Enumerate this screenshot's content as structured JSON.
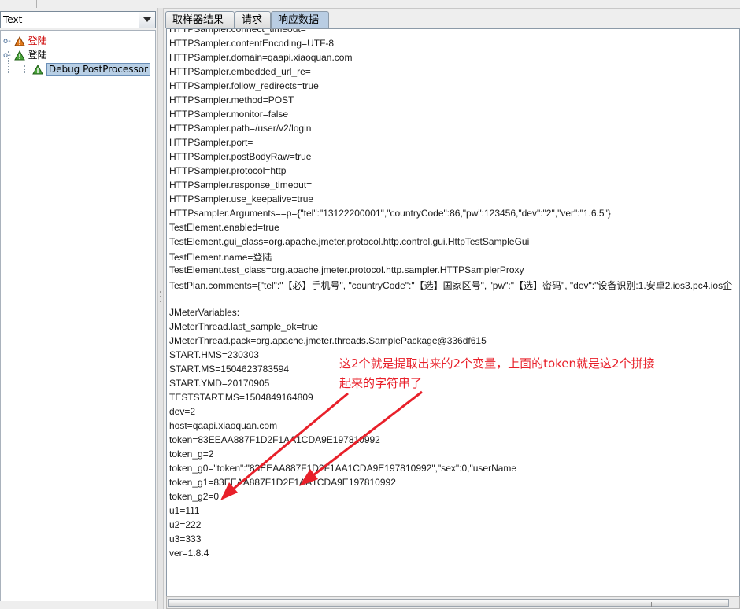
{
  "colors": {
    "annotation": "#e8202a",
    "tab_active": "#b9cde3",
    "tree_error_label": "#cc0000"
  },
  "left_panel": {
    "renderer_select": {
      "value": "Text"
    },
    "tree": [
      {
        "label": "登陆",
        "status": "error",
        "icon": "warning-triangle-icon"
      },
      {
        "label": "登陆",
        "status": "ok",
        "icon": "success-triangle-icon"
      },
      {
        "label": "Debug PostProcessor",
        "status": "ok",
        "icon": "success-triangle-icon",
        "selected": true
      }
    ]
  },
  "tabs": [
    {
      "label": "取样器结果"
    },
    {
      "label": "请求"
    },
    {
      "label": "响应数据",
      "active": true
    }
  ],
  "response_lines": [
    "HTTPSampler.connect_timeout=",
    "HTTPSampler.contentEncoding=UTF-8",
    "HTTPSampler.domain=qaapi.xiaoquan.com",
    "HTTPSampler.embedded_url_re=",
    "HTTPSampler.follow_redirects=true",
    "HTTPSampler.method=POST",
    "HTTPSampler.monitor=false",
    "HTTPSampler.path=/user/v2/login",
    "HTTPSampler.port=",
    "HTTPSampler.postBodyRaw=true",
    "HTTPSampler.protocol=http",
    "HTTPSampler.response_timeout=",
    "HTTPSampler.use_keepalive=true",
    "HTTPsampler.Arguments==p={\"tel\":\"13122200001\",\"countryCode\":86,\"pw\":123456,\"dev\":\"2\",\"ver\":\"1.6.5\"}",
    "TestElement.enabled=true",
    "TestElement.gui_class=org.apache.jmeter.protocol.http.control.gui.HttpTestSampleGui",
    "TestElement.name=登陆",
    "TestElement.test_class=org.apache.jmeter.protocol.http.sampler.HTTPSamplerProxy",
    "TestPlan.comments={\"tel\":\"【必】手机号\", \"countryCode\":\"【选】国家区号\", \"pw\":\"【选】密码\", \"dev\":\"设备识别:1.安卓2.ios3.pc4.ios企",
    "",
    "JMeterVariables:",
    "JMeterThread.last_sample_ok=true",
    "JMeterThread.pack=org.apache.jmeter.threads.SamplePackage@336df615",
    "START.HMS=230303",
    "START.MS=1504623783594",
    "START.YMD=20170905",
    "TESTSTART.MS=1504849164809",
    "dev=2",
    "host=qaapi.xiaoquan.com",
    "token=83EEAA887F1D2F1AA1CDA9E197810992",
    "token_g=2",
    "token_g0=\"token\":\"83EEAA887F1D2F1AA1CDA9E197810992\",\"sex\":0,\"userName",
    "token_g1=83EEAA887F1D2F1AA1CDA9E197810992",
    "token_g2=0",
    "u1=111",
    "u2=222",
    "u3=333",
    "ver=1.8.4"
  ],
  "annotation": {
    "line1": "这2个就是提取出来的2个变量，上面的token就是这2个拼接",
    "line2": "起来的字符串了"
  }
}
